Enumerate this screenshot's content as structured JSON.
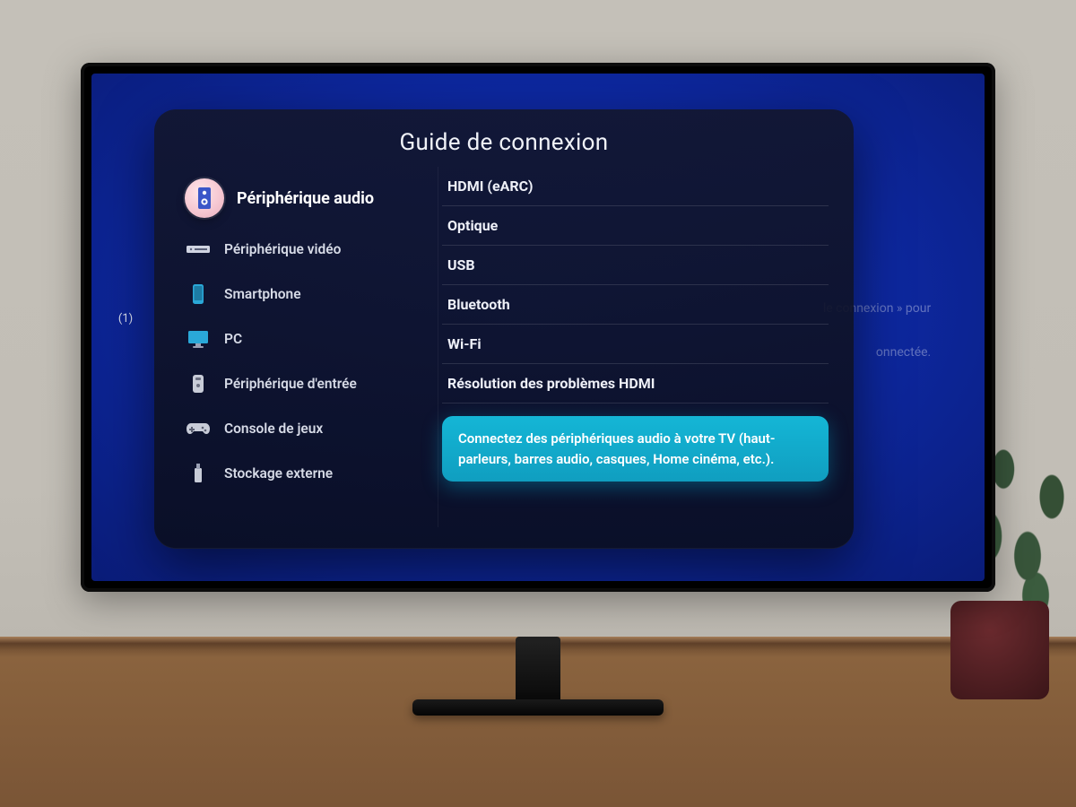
{
  "panel": {
    "title": "Guide de connexion",
    "categories": [
      {
        "label": "Périphérique audio",
        "icon": "speaker-icon",
        "selected": true
      },
      {
        "label": "Périphérique vidéo",
        "icon": "video-device-icon",
        "selected": false
      },
      {
        "label": "Smartphone",
        "icon": "smartphone-icon",
        "selected": false
      },
      {
        "label": "PC",
        "icon": "monitor-icon",
        "selected": false
      },
      {
        "label": "Périphérique d'entrée",
        "icon": "input-device-icon",
        "selected": false
      },
      {
        "label": "Console de jeux",
        "icon": "gamepad-icon",
        "selected": false
      },
      {
        "label": "Stockage externe",
        "icon": "storage-icon",
        "selected": false
      }
    ],
    "options": [
      "HDMI (eARC)",
      "Optique",
      "USB",
      "Bluetooth",
      "Wi-Fi",
      "Résolution des problèmes HDMI"
    ],
    "tip": "Connectez des périphériques audio à votre TV (haut-parleurs, barres audio, casques, Home cinéma, etc.)."
  },
  "background": {
    "footnote": "(1)",
    "hint_line1": "le connexion » pour",
    "hint_line2": "onnectée."
  }
}
